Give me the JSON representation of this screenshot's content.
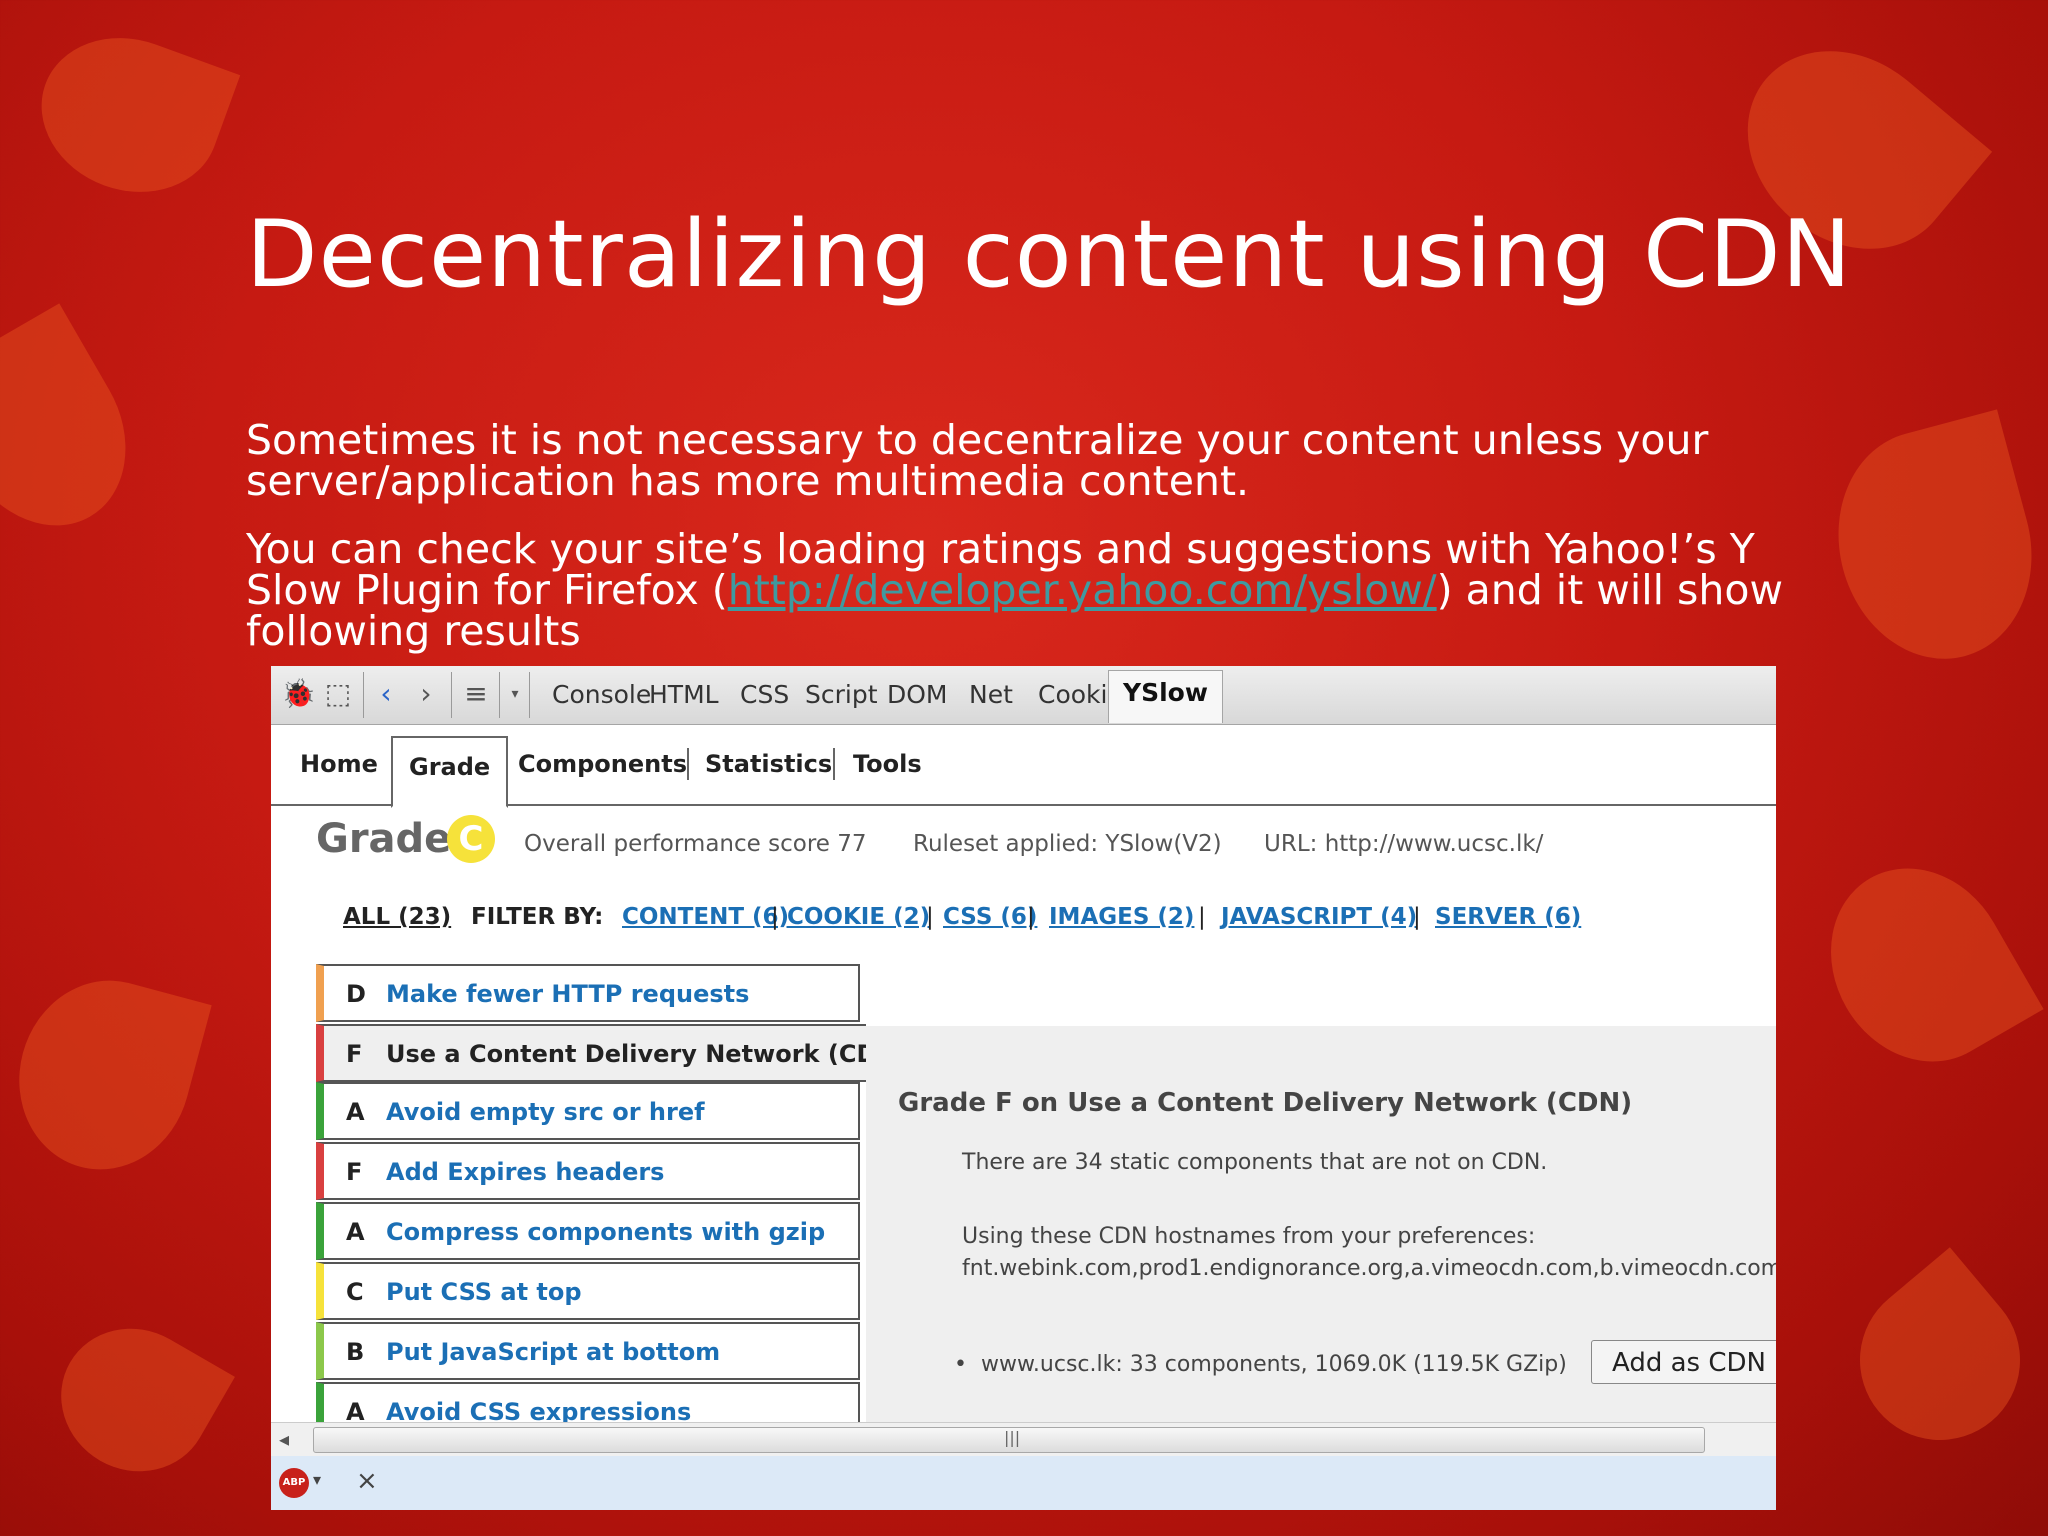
{
  "slide": {
    "title": "Decentralizing content using CDN",
    "para1": "Sometimes it is not necessary to decentralize your content unless your server/application has more multimedia content.",
    "para2_before": "You can check your site’s loading ratings and suggestions with Yahoo!’s Y Slow Plugin for Firefox (",
    "para2_link": "http://developer.yahoo.com/yslow/",
    "para2_after": ") and it will show following results"
  },
  "firebug": {
    "tabs": [
      "Console",
      "HTML",
      "CSS",
      "Script",
      "DOM",
      "Net",
      "Cookies",
      "YSlow"
    ],
    "active_tab": "YSlow"
  },
  "yslow": {
    "tabs": [
      "Home",
      "Grade",
      "Components",
      "Statistics",
      "Tools"
    ],
    "active_tab": "Grade",
    "grade_label": "Grade",
    "grade": "C",
    "score_text": "Overall performance score 77",
    "ruleset_text": "Ruleset applied: YSlow(V2)",
    "url_text": "URL: http://www.ucsc.lk/",
    "filter_all": "ALL (23)",
    "filter_by": "FILTER BY:",
    "filters": [
      "CONTENT (6)",
      "COOKIE (2)",
      "CSS (6)",
      "IMAGES (2)",
      "JAVASCRIPT (4)",
      "SERVER (6)"
    ],
    "rules": [
      {
        "grade": "D",
        "title": "Make fewer HTTP requests",
        "color": "#f0a050"
      },
      {
        "grade": "F",
        "title": "Use a Content Delivery Network (CDN)",
        "color": "#d94040"
      },
      {
        "grade": "A",
        "title": "Avoid empty src or href",
        "color": "#3aa33a"
      },
      {
        "grade": "F",
        "title": "Add Expires headers",
        "color": "#d94040"
      },
      {
        "grade": "A",
        "title": "Compress components with gzip",
        "color": "#3aa33a"
      },
      {
        "grade": "C",
        "title": "Put CSS at top",
        "color": "#f6e23a"
      },
      {
        "grade": "B",
        "title": "Put JavaScript at bottom",
        "color": "#8cc84b"
      },
      {
        "grade": "A",
        "title": "Avoid CSS expressions",
        "color": "#3aa33a"
      }
    ],
    "detail": {
      "title": "Grade F on Use a Content Delivery Network (CDN)",
      "line1": "There are 34 static components that are not on CDN.",
      "line2": "Using these CDN hostnames from your preferences:",
      "line3": "fnt.webink.com,prod1.endignorance.org,a.vimeocdn.com,b.vimeocdn.com",
      "bullet": "www.ucsc.lk: 33 components, 1069.0K (119.5K GZip)",
      "add_button": "Add as CDN"
    }
  },
  "statusbar": {
    "abp_label": "ABP",
    "close": "×"
  }
}
